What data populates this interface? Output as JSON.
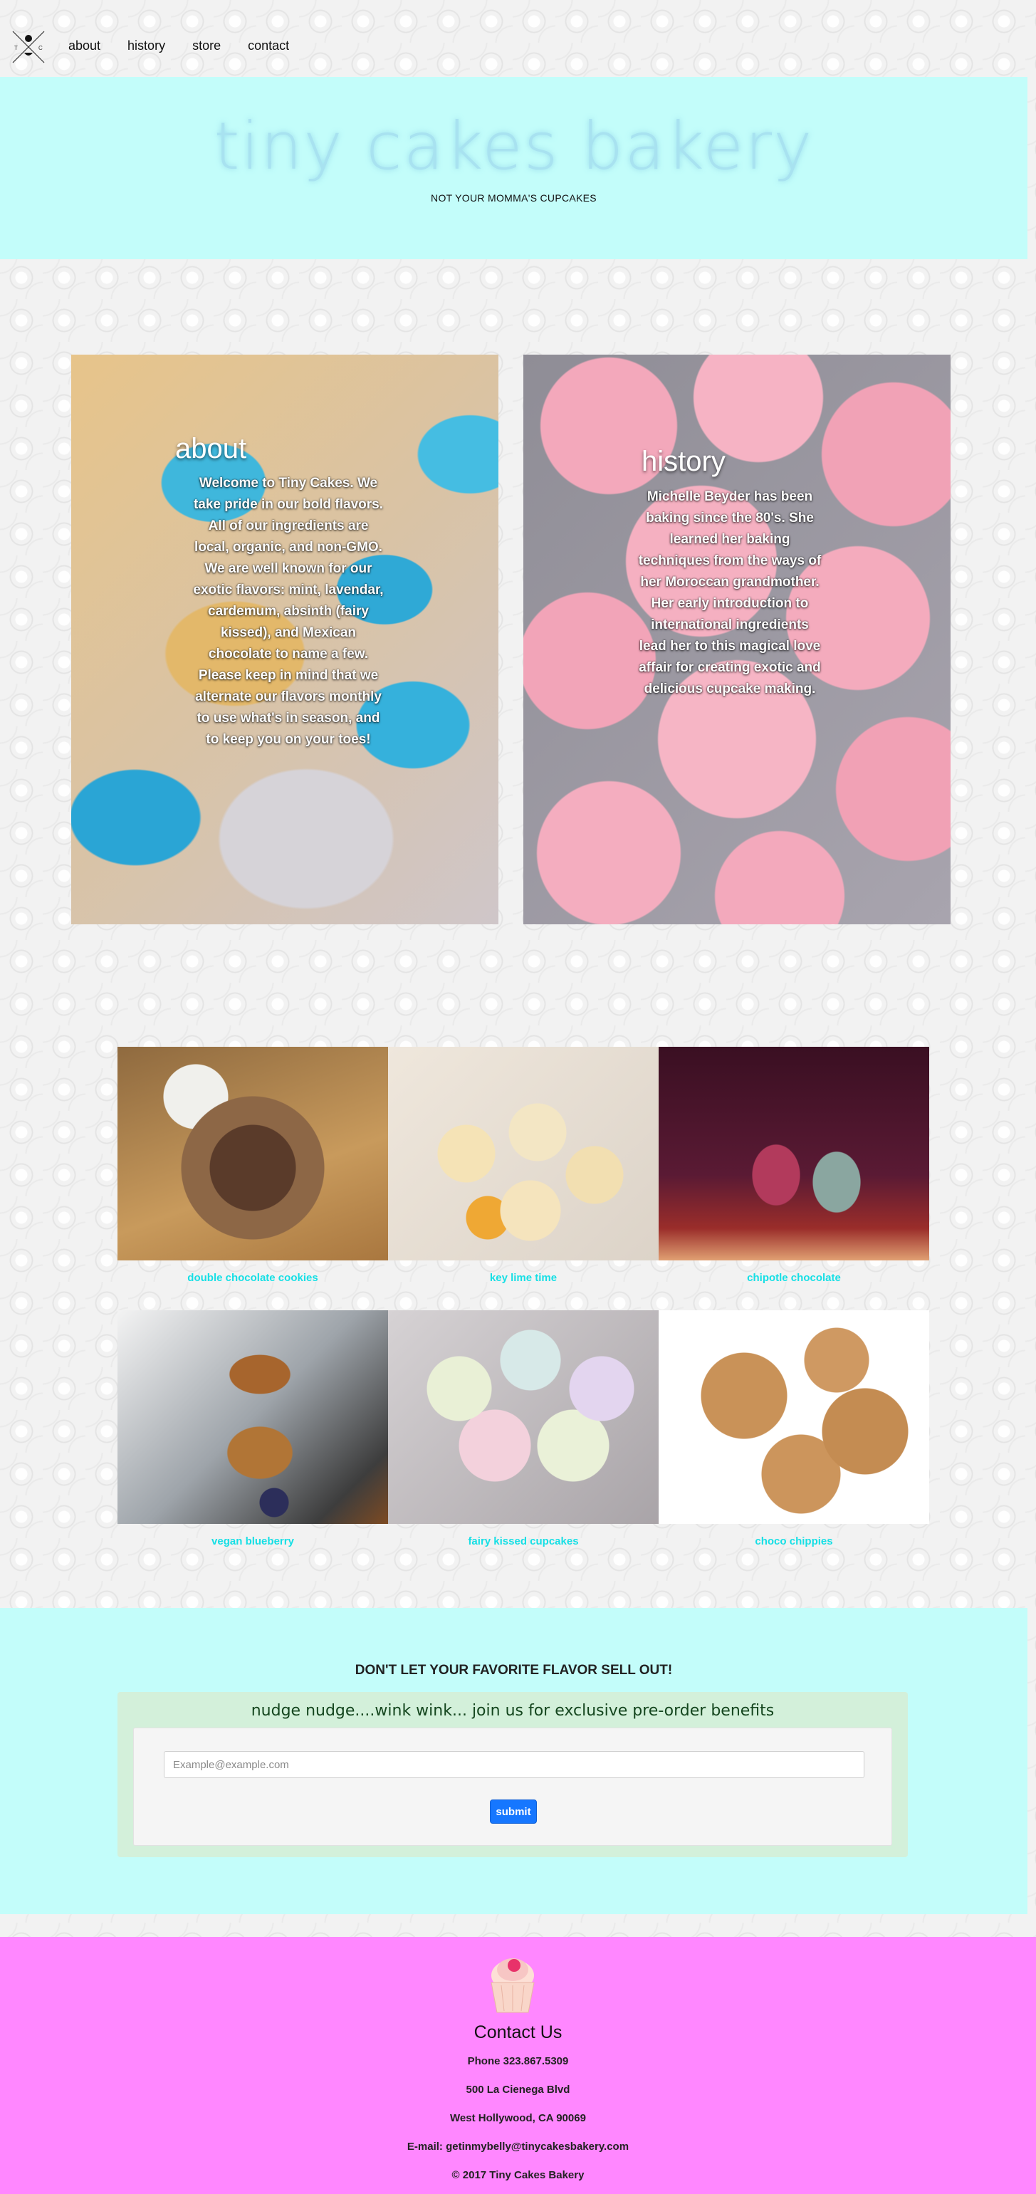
{
  "nav": {
    "logo_letters": [
      "T",
      "C"
    ],
    "links": [
      "about",
      "history",
      "store",
      "contact"
    ]
  },
  "hero": {
    "title": "tiny cakes bakery",
    "subtitle": "NOT YOUR MOMMA'S CUPCAKES"
  },
  "about": {
    "title": "about",
    "text": "Welcome to Tiny Cakes. We take pride in our bold flavors. All of our ingredients are local, organic, and non-GMO. We are well known for our exotic flavors: mint, lavendar, cardemum, absinth (fairy kissed), and Mexican chocolate to name a few. Please keep in mind that we alternate our flavors monthly to use what's in season, and to keep you on your toes!"
  },
  "history": {
    "title": "history",
    "text": "Michelle Beyder has been baking since the 80's. She learned her baking techniques from the ways of her Moroccan grandmother. Her early introduction to international ingredients lead her to this magical love affair for creating exotic and delicious cupcake making."
  },
  "gallery": {
    "items": [
      {
        "caption": "double chocolate cookies"
      },
      {
        "caption": "key lime time"
      },
      {
        "caption": "chipotle chocolate"
      },
      {
        "caption": "vegan blueberry"
      },
      {
        "caption": "fairy kissed cupcakes"
      },
      {
        "caption": "choco chippies"
      }
    ]
  },
  "preorder": {
    "heading": "DON'T LET YOUR FAVORITE FLAVOR SELL OUT!",
    "lead": "nudge nudge....wink wink... join us for exclusive pre-order benefits",
    "email_placeholder": "Example@example.com",
    "submit_label": "submit"
  },
  "footer": {
    "title": "Contact Us",
    "phone": "Phone 323.867.5309",
    "street": "500 La Cienega Blvd",
    "city": "West Hollywood, CA 90069",
    "email": "E-mail: getinmybelly@tinycakesbakery.com",
    "copyright": "© 2017 Tiny Cakes Bakery"
  },
  "colors": {
    "hero_bg": "#c3fdfa",
    "caption": "#16dfe5",
    "submit_bg": "#1677ff",
    "footer_bg": "#ff87ff"
  }
}
